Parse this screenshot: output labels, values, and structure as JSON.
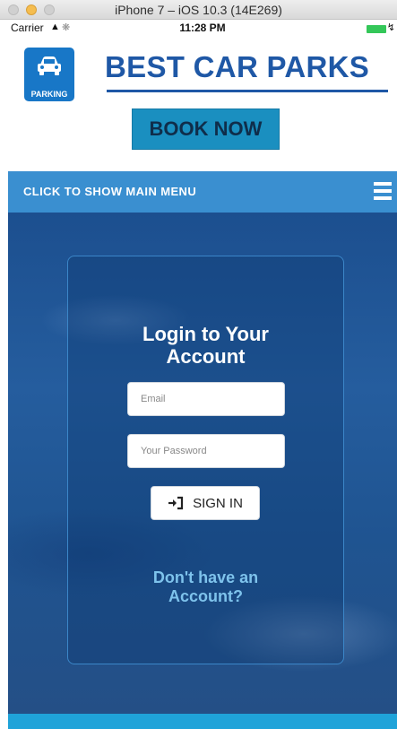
{
  "simulator": {
    "title": "iPhone 7 – iOS 10.3 (14E269)"
  },
  "statusbar": {
    "carrier": "Carrier",
    "time": "11:28 PM"
  },
  "header": {
    "badge_label": "PARKING",
    "brand": "BEST CAR PARKS",
    "book_now": "BOOK NOW",
    "brand_color": "#1f58a6",
    "button_color": "#1a8fc0"
  },
  "menu": {
    "toggle_label": "CLICK TO SHOW MAIN MENU",
    "bar_color": "#3a8fd0"
  },
  "login": {
    "title_line1": "Login to Your",
    "title_line2": "Account",
    "email_placeholder": "Email",
    "password_placeholder": "Your Password",
    "signin_label": "SIGN IN",
    "signup_line1": "Don't have an",
    "signup_line2": "Account?"
  }
}
